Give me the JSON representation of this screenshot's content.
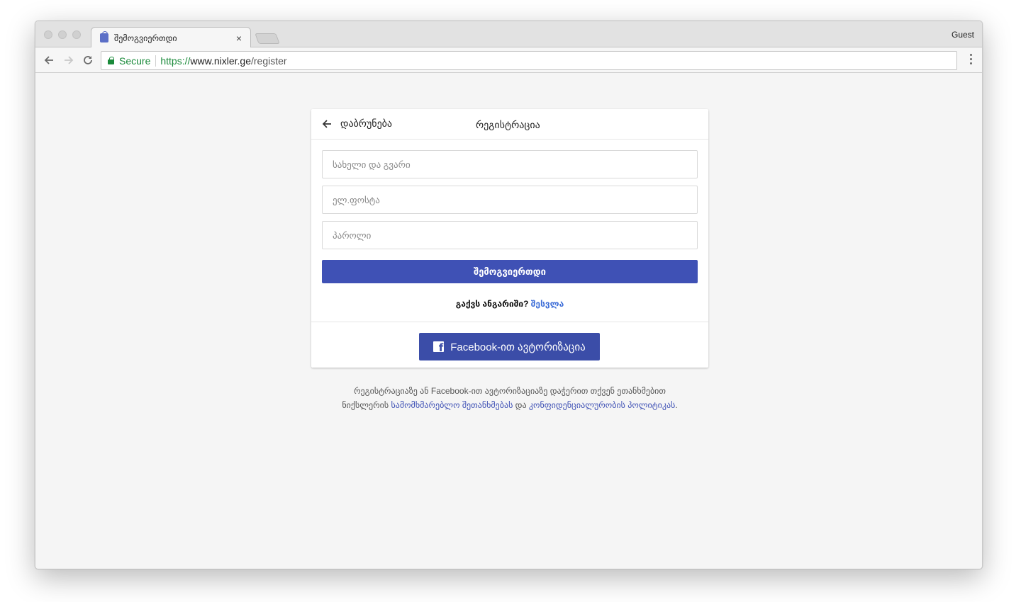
{
  "browser": {
    "tab_title": "შემოგვიერთდი",
    "tab_close": "×",
    "profile": "Guest",
    "secure_label": "Secure",
    "url_scheme": "https://",
    "url_host": "www.nixler.ge",
    "url_path": "/register",
    "icons": {
      "back": "arrow-left-icon",
      "forward": "arrow-right-icon",
      "reload": "reload-icon",
      "lock": "lock-icon",
      "menu": "vertical-dots-icon"
    }
  },
  "card": {
    "back_label": "დაბრუნება",
    "title": "რეგისტრაცია",
    "fields": {
      "name_placeholder": "სახელი და გვარი",
      "email_placeholder": "ელ.ფოსტა",
      "password_placeholder": "პაროლი"
    },
    "submit_label": "შემოგვიერთდი",
    "have_account": "გაქვს ანგარიში?",
    "login_link": "შესვლა",
    "facebook_label": "Facebook-ით ავტორიზაცია"
  },
  "terms": {
    "line1": "რეგისტრაციაზე ან Facebook-ით ავტორიზაციაზე დაჭერით თქვენ ეთანხმებით",
    "prefix": "ნიქსლერის ",
    "link1": "სამომხმარებლო შეთანხმებას",
    "middle": " და ",
    "link2": "კონფიდენციალურობის პოლიტიკას",
    "suffix": "."
  },
  "colors": {
    "primary": "#3f51b5",
    "facebook": "#3b4da8",
    "secure_green": "#1a8a3a",
    "link": "#3f6fd8"
  }
}
